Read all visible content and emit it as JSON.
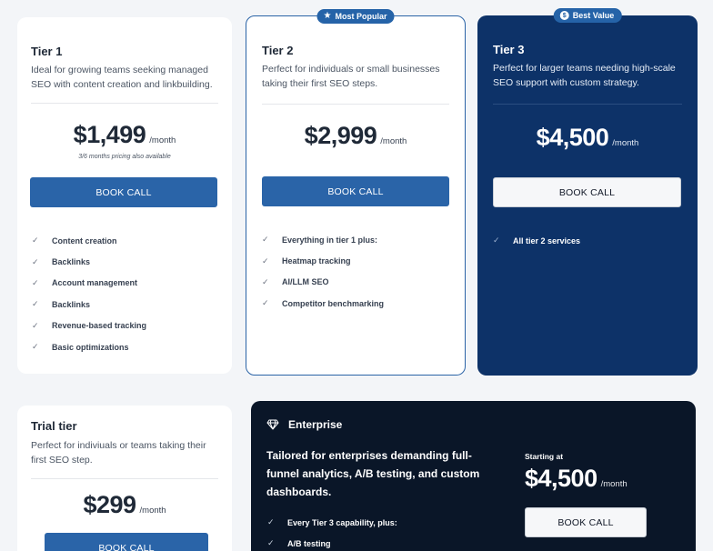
{
  "tiers": [
    {
      "name": "Tier 1",
      "description": "Ideal for growing teams seeking managed SEO with content creation and linkbuilding.",
      "price": "$1,499",
      "period": "/month",
      "note": "3/6 months pricing also available",
      "button": "BOOK CALL",
      "features": [
        "Content creation",
        "Backlinks",
        "Account management",
        "Backlinks",
        "Revenue-based tracking",
        "Basic optimizations"
      ]
    },
    {
      "badge": "Most Popular",
      "name": "Tier 2",
      "description": "Perfect for individuals or small businesses taking their first SEO steps.",
      "price": "$2,999",
      "period": "/month",
      "button": "BOOK CALL",
      "features": [
        "Everything in tier 1 plus:",
        "Heatmap tracking",
        "AI/LLM SEO",
        "Competitor benchmarking"
      ]
    },
    {
      "badge": "Best Value",
      "name": "Tier 3",
      "description": "Perfect for larger teams needing high-scale SEO support with custom strategy.",
      "price": "$4,500",
      "period": "/month",
      "button": "BOOK CALL",
      "features": [
        "All tier 2 services"
      ]
    }
  ],
  "trial": {
    "name": "Trial tier",
    "description": "Perfect for indiviuals or teams taking their first SEO step.",
    "price": "$299",
    "period": "/month",
    "button": "BOOK CALL"
  },
  "enterprise": {
    "name": "Enterprise",
    "tagline": "Tailored for enterprises demanding full-funnel analytics, A/B testing, and custom dashboards.",
    "starting_label": "Starting at",
    "price": "$4,500",
    "period": "/month",
    "button": "BOOK CALL",
    "features": [
      "Every Tier 3 capability, plus:",
      "A/B testing"
    ]
  },
  "icons": {
    "most_popular": "star-icon",
    "best_value": "dollar-coin-icon",
    "enterprise": "diamond-icon",
    "feature": "check-icon"
  },
  "colors": {
    "primary_button": "#2a64a8",
    "tier3_background": "#0d3268",
    "enterprise_background": "#0a1628",
    "badge": "#2563a8"
  }
}
